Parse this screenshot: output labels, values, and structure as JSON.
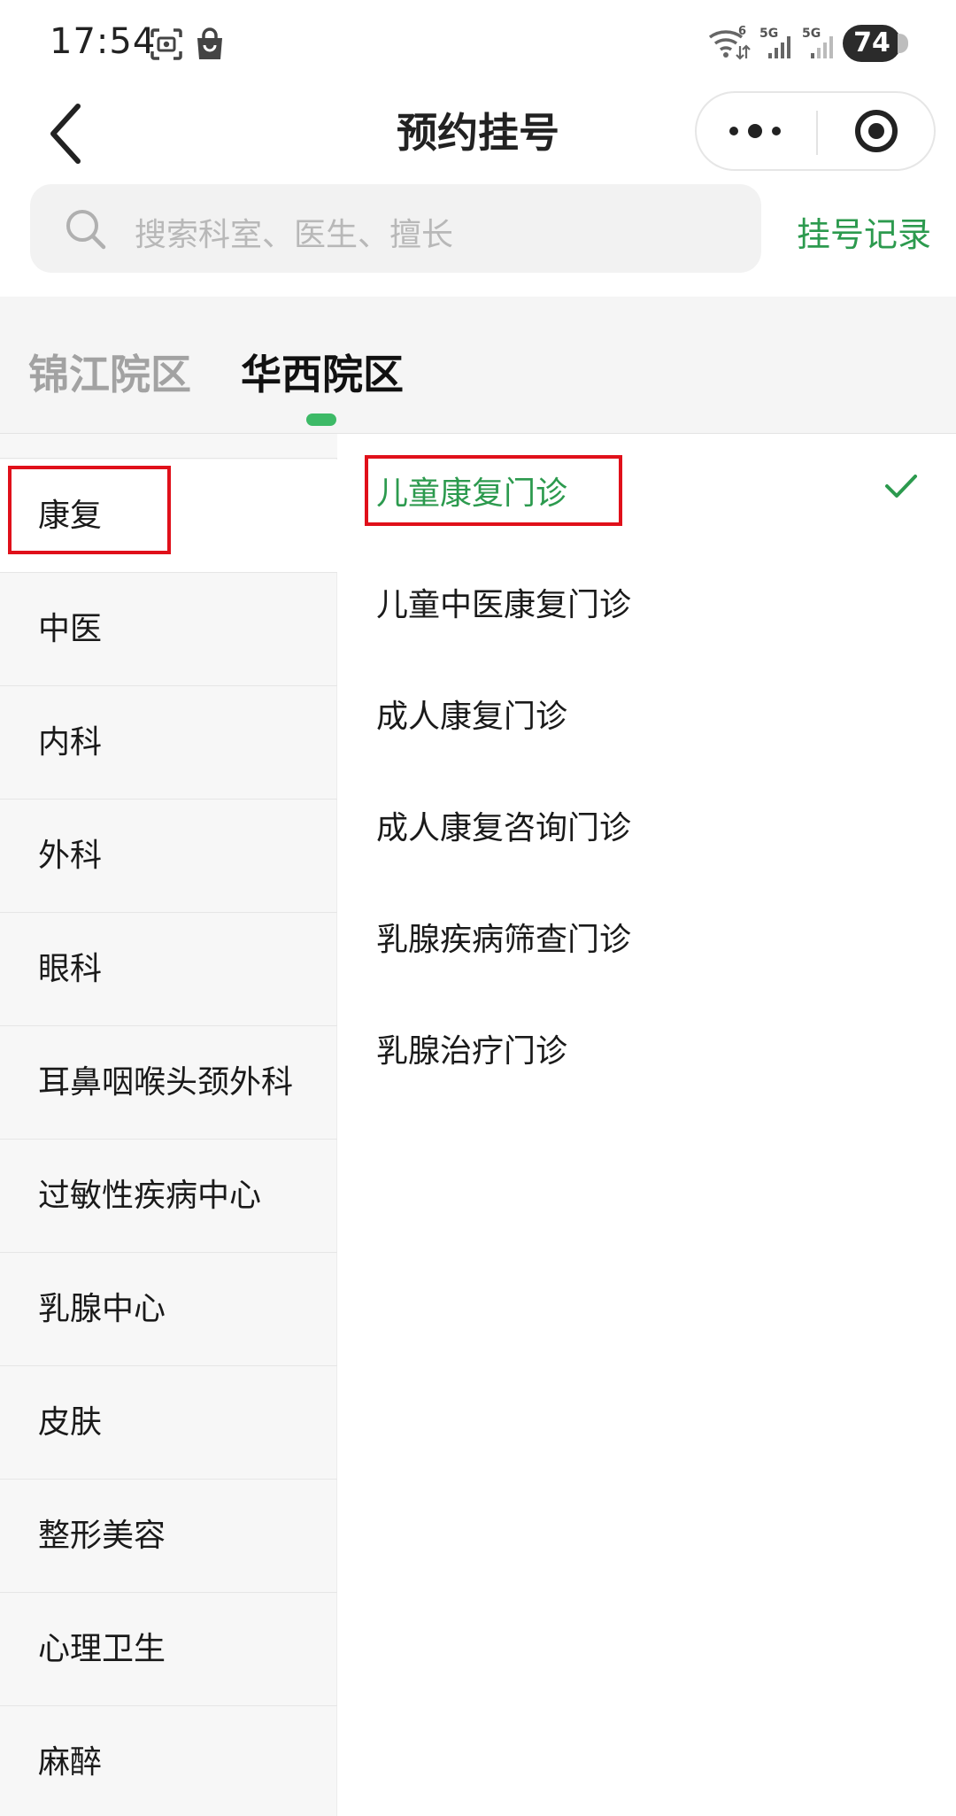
{
  "status_bar": {
    "time": "17:54",
    "battery": "74",
    "icons": [
      "screenshot-icon",
      "shopping-bag-icon",
      "wifi-icon",
      "signal-5g-icon",
      "signal-5g-icon"
    ],
    "network_labels": [
      "5G",
      "5G"
    ],
    "wifi_badge": "6"
  },
  "nav": {
    "title": "预约挂号",
    "back_icon": "chevron-left-icon",
    "more_icon": "more-dots-icon",
    "close_icon": "target-close-icon"
  },
  "search": {
    "placeholder": "搜索科室、医生、擅长",
    "record_link": "挂号记录"
  },
  "campus_tabs": [
    {
      "label": "锦江院区",
      "active": false
    },
    {
      "label": "华西院区",
      "active": true
    }
  ],
  "departments": [
    {
      "label": "康复",
      "active": true
    },
    {
      "label": "中医"
    },
    {
      "label": "内科"
    },
    {
      "label": "外科"
    },
    {
      "label": "眼科"
    },
    {
      "label": "耳鼻咽喉头颈外科"
    },
    {
      "label": "过敏性疾病中心"
    },
    {
      "label": "乳腺中心"
    },
    {
      "label": "皮肤"
    },
    {
      "label": "整形美容"
    },
    {
      "label": "心理卫生"
    },
    {
      "label": "麻醉"
    }
  ],
  "clinics": [
    {
      "label": "儿童康复门诊",
      "selected": true
    },
    {
      "label": "儿童中医康复门诊"
    },
    {
      "label": "成人康复门诊"
    },
    {
      "label": "成人康复咨询门诊"
    },
    {
      "label": "乳腺疾病筛查门诊"
    },
    {
      "label": "乳腺治疗门诊"
    }
  ],
  "colors": {
    "accent_green": "#2c9a4e",
    "indicator_green": "#3dba67",
    "annotation_red": "#e0101a"
  }
}
